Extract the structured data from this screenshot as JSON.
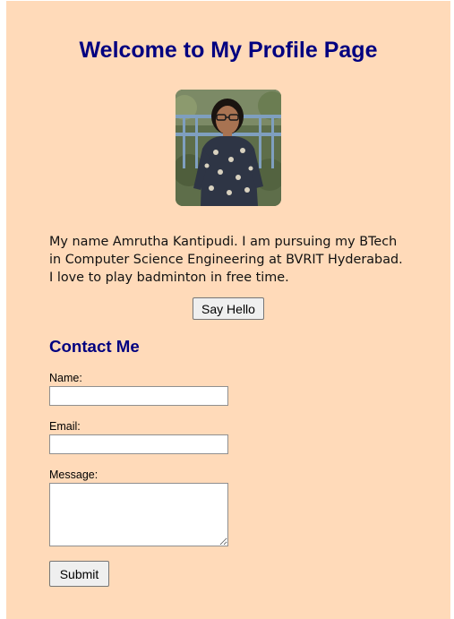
{
  "page": {
    "title": "Welcome to My Profile Page",
    "photo_alt": "Profile photo"
  },
  "bio": {
    "text": "My name Amrutha Kantipudi. I am pursuing my BTech in Computer Science Engineering at BVRIT Hyderabad. I love to play badminton in free time."
  },
  "hello_button": {
    "label": "Say Hello"
  },
  "contact": {
    "title": "Contact Me",
    "name_label": "Name:",
    "name_value": "",
    "email_label": "Email:",
    "email_value": "",
    "message_label": "Message:",
    "message_value": "",
    "submit_label": "Submit"
  },
  "colors": {
    "background": "#ffdab9",
    "heading": "#000080"
  }
}
